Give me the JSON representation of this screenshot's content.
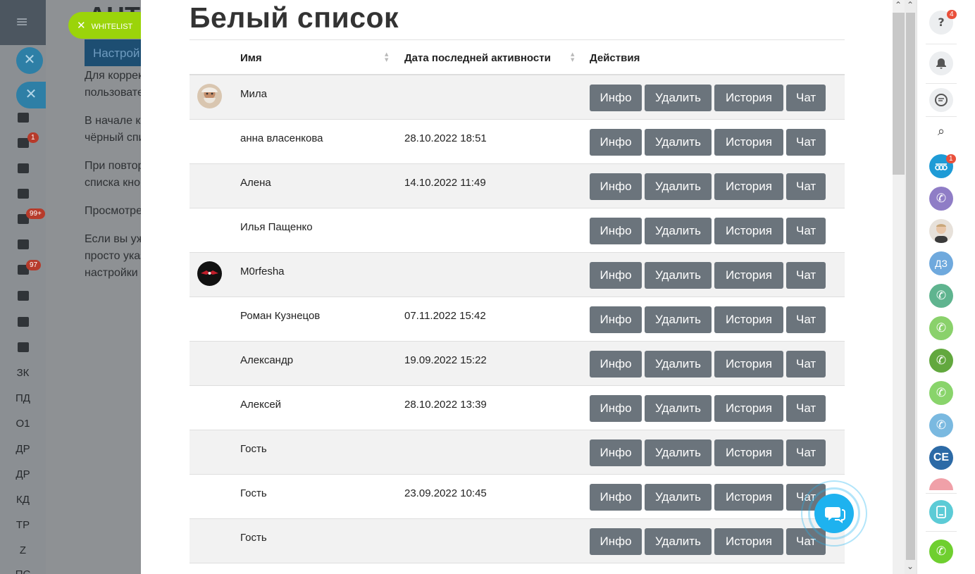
{
  "background": {
    "title": "АНТ",
    "button_label": "Настрой",
    "paragraphs": [
      "Для коррек",
      "пользовате",
      "В начале ка",
      "чёрный спи",
      "При повтор",
      "списка кно",
      "Просмотре",
      "Если вы уж",
      "просто указ",
      "настройки"
    ],
    "nav_badges": [
      "1",
      "99+",
      "97"
    ],
    "nav_labels": [
      "ЗК",
      "ПД",
      "О1",
      "ДР",
      "ДР",
      "КД",
      "ТР",
      "Z",
      "ПС"
    ]
  },
  "whitelist_chip": {
    "label": "WHITELIST"
  },
  "modal": {
    "title": "Белый список",
    "columns": {
      "name": "Имя",
      "date": "Дата последней активности",
      "actions": "Действия"
    },
    "action_labels": {
      "info": "Инфо",
      "delete": "Удалить",
      "history": "История",
      "chat": "Чат"
    },
    "rows": [
      {
        "name": "Мила",
        "date": "",
        "avatar": "photo-elder"
      },
      {
        "name": "анна власенкова",
        "date": "28.10.2022 18:51",
        "avatar": ""
      },
      {
        "name": "Алена",
        "date": "14.10.2022 11:49",
        "avatar": ""
      },
      {
        "name": "Илья Пащенко",
        "date": "",
        "avatar": ""
      },
      {
        "name": "M0rfesha",
        "date": "",
        "avatar": "photo-dark"
      },
      {
        "name": "Роман Кузнецов",
        "date": "07.11.2022 15:42",
        "avatar": ""
      },
      {
        "name": "Александр",
        "date": "19.09.2022 15:22",
        "avatar": ""
      },
      {
        "name": "Алексей",
        "date": "28.10.2022 13:39",
        "avatar": ""
      },
      {
        "name": "Гость",
        "date": "",
        "avatar": ""
      },
      {
        "name": "Гость",
        "date": "23.09.2022 10:45",
        "avatar": ""
      },
      {
        "name": "Гость",
        "date": "",
        "avatar": ""
      }
    ]
  },
  "right_panel": {
    "help_badge": "4",
    "openlines_badge": "1",
    "initials_1": "ДЗ",
    "initials_2": "CE"
  },
  "colors": {
    "accent": "#1eb2ef",
    "button": "#6b747c",
    "chip": "#9bd40a",
    "call": "#6fcf2f"
  }
}
